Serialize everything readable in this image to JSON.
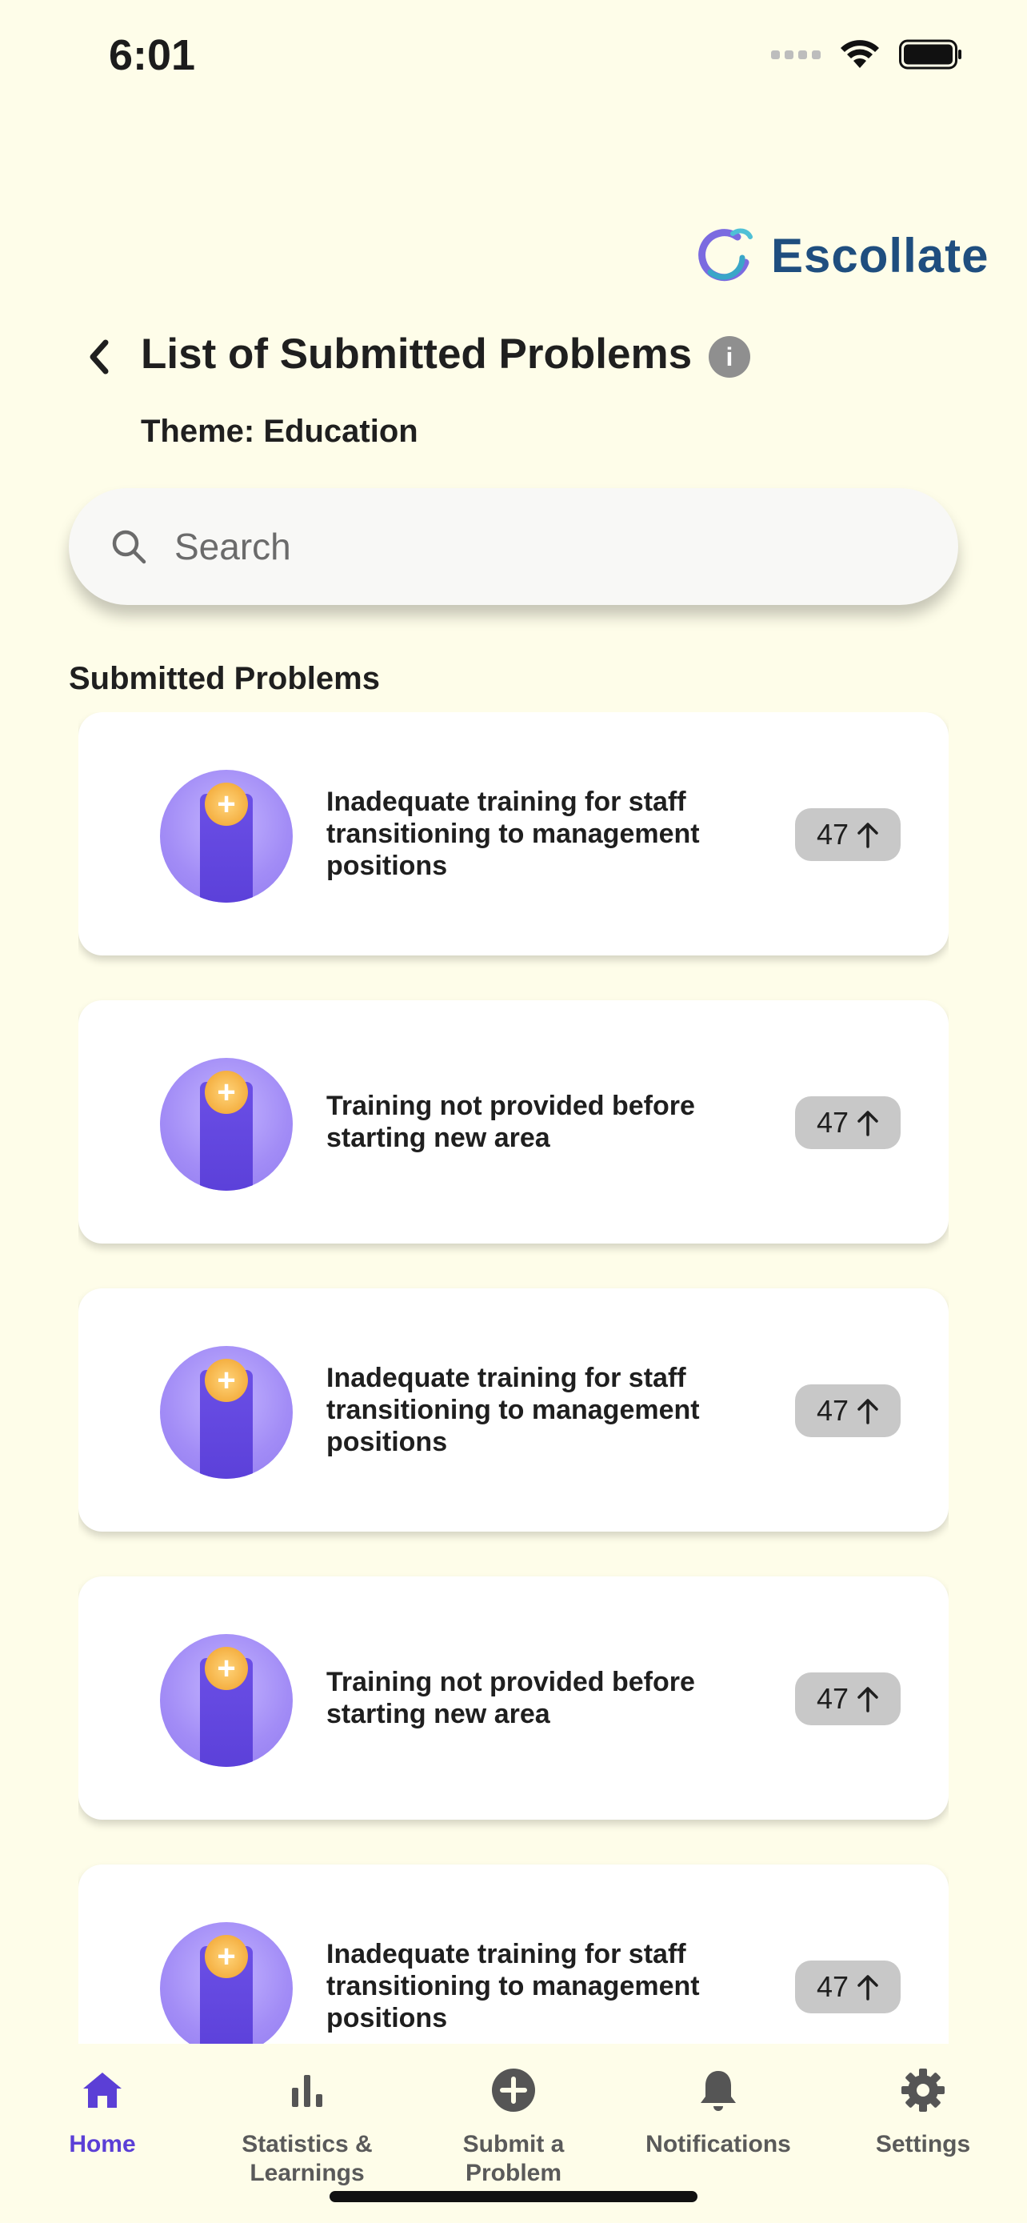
{
  "status_bar": {
    "time": "6:01"
  },
  "brand": {
    "name": "Escollate",
    "color": "#1f4e7f"
  },
  "header": {
    "title": "List of Submitted Problems",
    "theme_label": "Theme: Education",
    "info_icon": "info-icon",
    "back_icon": "chevron-left-icon"
  },
  "search": {
    "placeholder": "Search",
    "value": ""
  },
  "section": {
    "title": "Submitted Problems"
  },
  "problems": [
    {
      "text": "Inadequate training for staff transitioning to management positions",
      "votes": "47"
    },
    {
      "text": "Training not provided before starting new area",
      "votes": "47"
    },
    {
      "text": "Inadequate training for staff transitioning to management positions",
      "votes": "47"
    },
    {
      "text": "Training not provided before starting new area",
      "votes": "47"
    },
    {
      "text": "Inadequate training for staff transitioning to management positions",
      "votes": "47"
    }
  ],
  "tab_bar": {
    "active": "home",
    "tabs": [
      {
        "id": "home",
        "label": "Home",
        "icon": "home-icon"
      },
      {
        "id": "statistics",
        "label": "Statistics & Learnings",
        "icon": "bar-chart-icon"
      },
      {
        "id": "submit",
        "label": "Submit a Problem",
        "icon": "plus-circle-icon"
      },
      {
        "id": "notifications",
        "label": "Notifications",
        "icon": "bell-icon"
      },
      {
        "id": "settings",
        "label": "Settings",
        "icon": "gear-icon"
      }
    ]
  },
  "colors": {
    "background": "#fefde9",
    "accent": "#5b3fd6",
    "badge": "#c8c8c8"
  }
}
